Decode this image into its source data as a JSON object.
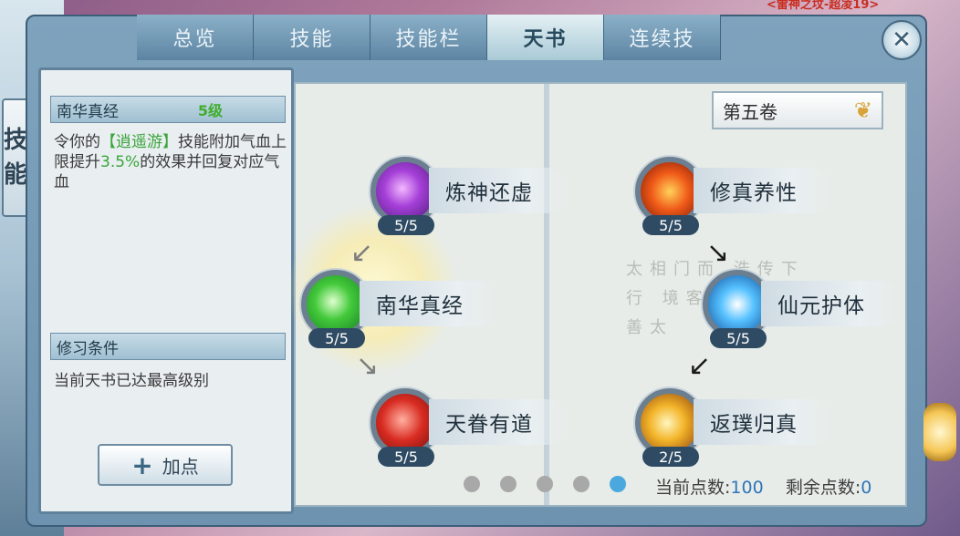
{
  "header_text": "<雷神之坟-超凌19>",
  "side_tab": {
    "label": "技能"
  },
  "tabs": [
    {
      "label": "总览",
      "active": false
    },
    {
      "label": "技能",
      "active": false
    },
    {
      "label": "技能栏",
      "active": false
    },
    {
      "label": "天书",
      "active": true
    },
    {
      "label": "连续技",
      "active": false
    }
  ],
  "close_label": "✕",
  "detail": {
    "name": "南华真经",
    "level": "5级",
    "description_prefix": "令你的",
    "description_skill": "【逍遥游】",
    "description_mid": "技能附加气血上限提升",
    "description_value": "3.5%",
    "description_suffix": "的效果并回复对应气血",
    "condition_header": "修习条件",
    "condition_text": "当前天书已达最高级别",
    "add_button_label": "加点",
    "add_button_icon": "+"
  },
  "volume": {
    "label": "第五卷",
    "icon": "lotus-icon"
  },
  "nodes": [
    {
      "name": "炼神还虚",
      "count": "5/5",
      "icon": "purple-crystal-icon",
      "color": "#a53fd8"
    },
    {
      "name": "南华真经",
      "count": "5/5",
      "icon": "green-spark-icon",
      "color": "#43c93a"
    },
    {
      "name": "天眷有道",
      "count": "5/5",
      "icon": "red-chain-icon",
      "color": "#d92c22"
    },
    {
      "name": "修真养性",
      "count": "5/5",
      "icon": "fire-figure-icon",
      "color": "#f05a18"
    },
    {
      "name": "仙元护体",
      "count": "5/5",
      "icon": "blue-shield-icon",
      "color": "#57c2ff"
    },
    {
      "name": "返璞归真",
      "count": "2/5",
      "icon": "gold-swirl-icon",
      "color": "#f3b52a"
    }
  ],
  "watermark_text": "太相门而 浩传下行 境客转阶 为云善太",
  "pagination": {
    "total": 5,
    "active_index": 4
  },
  "points": {
    "current_label": "当前点数:",
    "current_value": "100",
    "remaining_label": "剩余点数:",
    "remaining_value": "0"
  },
  "colors": {
    "accent": "#2f75b8",
    "highlight": "#3aa53a",
    "panel": "#6d93b0"
  }
}
